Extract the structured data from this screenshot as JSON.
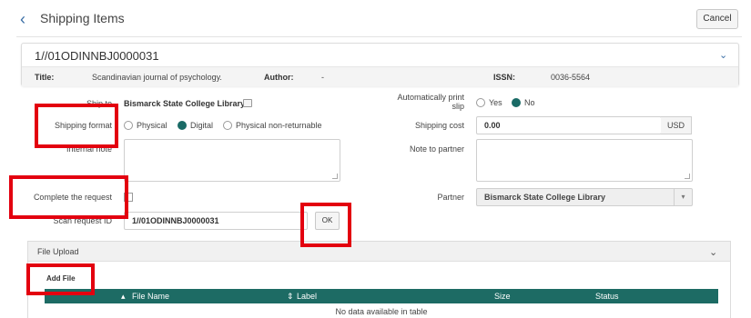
{
  "header": {
    "title": "Shipping Items",
    "cancel_label": "Cancel"
  },
  "record": {
    "id": "1//01ODINNBJ0000031",
    "title_label": "Title:",
    "title_value": "Scandinavian journal of psychology.",
    "author_label": "Author:",
    "author_value": "-",
    "issn_label": "ISSN:",
    "issn_value": "0036-5564"
  },
  "form": {
    "ship_to_label": "Ship to",
    "ship_to_value": "Bismarck State College Library",
    "auto_print_label_1": "Automatically print",
    "auto_print_label_2": "slip",
    "auto_print_yes": "Yes",
    "auto_print_no": "No",
    "shipping_format_label": "Shipping format",
    "format_physical": "Physical",
    "format_digital": "Digital",
    "format_nonreturnable": "Physical non-returnable",
    "shipping_cost_label": "Shipping cost",
    "shipping_cost_value": "0.00",
    "currency": "USD",
    "internal_note_label": "Internal note",
    "note_to_partner_label": "Note to partner",
    "complete_request_label": "Complete the request",
    "partner_label": "Partner",
    "partner_value": "Bismarck State College Library",
    "scan_request_label": "Scan request ID",
    "scan_request_value": "1//01ODINNBJ0000031",
    "ok_label": "OK"
  },
  "upload": {
    "title": "File Upload",
    "add_file_label": "Add File",
    "columns": [
      "File Name",
      "Label",
      "Size",
      "Status"
    ],
    "empty_text": "No data available in table"
  },
  "colors": {
    "accent": "#1d6b64",
    "link": "#3a6ea5",
    "highlight": "#e3000f"
  }
}
